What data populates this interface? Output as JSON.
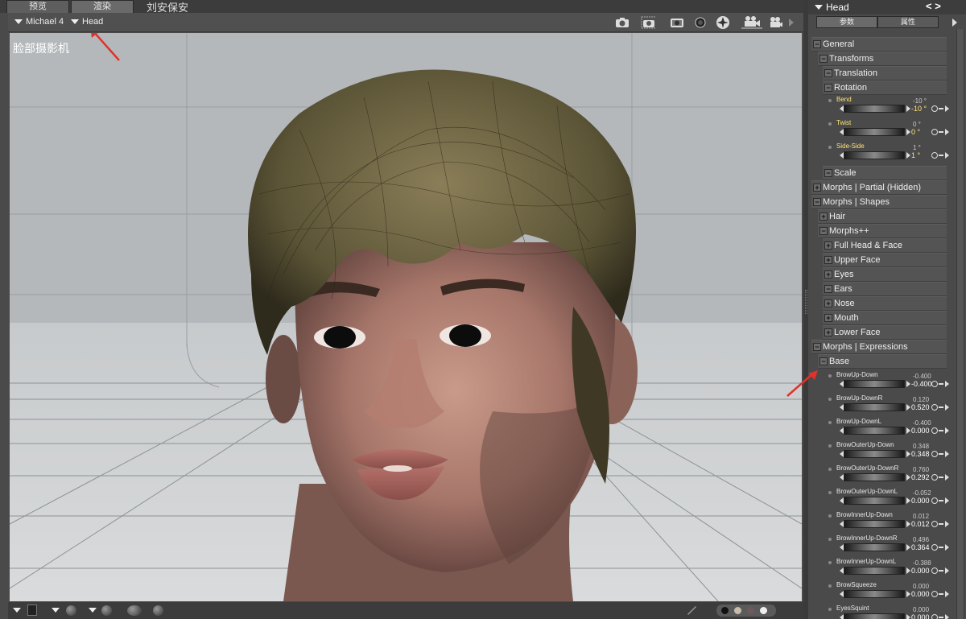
{
  "viewport": {
    "tabs": [
      "预览",
      "渲染"
    ],
    "username": "刘安保安",
    "figure_selector": "Michael 4",
    "part_selector": "Head",
    "camera_label": "脸部摄影机",
    "toolbar_icons": [
      "camera-icon",
      "camera-icon",
      "camera-icon",
      "circle-icon",
      "light-icon",
      "camera-icon",
      "camera-icon",
      "chevron-right-icon"
    ]
  },
  "panel": {
    "title": "Head",
    "tabs": [
      "参数",
      "属性"
    ],
    "groups": [
      {
        "label": "General",
        "state": "−"
      },
      {
        "label": "Transforms",
        "state": "−"
      },
      {
        "label": "Translation",
        "state": "−"
      },
      {
        "label": "Rotation",
        "state": "−"
      },
      {
        "label": "Scale",
        "state": "−"
      },
      {
        "label": "Morphs | Partial (Hidden)",
        "state": "+"
      },
      {
        "label": "Morphs | Shapes",
        "state": "−"
      },
      {
        "label": "Hair",
        "state": "+"
      },
      {
        "label": "Morphs++",
        "state": "−"
      },
      {
        "label": "Full Head & Face",
        "state": "+"
      },
      {
        "label": "Upper Face",
        "state": "+"
      },
      {
        "label": "Eyes",
        "state": "+"
      },
      {
        "label": "Ears",
        "state": "−"
      },
      {
        "label": "Nose",
        "state": "+"
      },
      {
        "label": "Mouth",
        "state": "+"
      },
      {
        "label": "Lower Face",
        "state": "+"
      },
      {
        "label": "Morphs | Expressions",
        "state": "−"
      },
      {
        "label": "Base",
        "state": "−"
      }
    ],
    "rotation_dials": [
      {
        "label": "Bend",
        "default": "-10 °",
        "value": "-10 °"
      },
      {
        "label": "Twist",
        "default": "0 °",
        "value": "0 °"
      },
      {
        "label": "Side-Side",
        "default": "1 °",
        "value": "1 °"
      }
    ],
    "base_dials": [
      {
        "label": "BrowUp-Down",
        "default": "-0.400",
        "value": "-0.400"
      },
      {
        "label": "BrowUp-DownR",
        "default": "0.120",
        "value": "0.520"
      },
      {
        "label": "BrowUp-DownL",
        "default": "-0.400",
        "value": "0.000"
      },
      {
        "label": "BrowOuterUp-Down",
        "default": "0.348",
        "value": "0.348"
      },
      {
        "label": "BrowOuterUp-DownR",
        "default": "0.760",
        "value": "0.292"
      },
      {
        "label": "BrowOuterUp-DownL",
        "default": "-0.052",
        "value": "0.000"
      },
      {
        "label": "BrowInnerUp-Down",
        "default": "0.012",
        "value": "0.012"
      },
      {
        "label": "BrowInnerUp-DownR",
        "default": "0.496",
        "value": "0.364"
      },
      {
        "label": "BrowInnerUp-DownL",
        "default": "-0.388",
        "value": "0.000"
      },
      {
        "label": "BrowSqueeze",
        "default": "0.000",
        "value": "0.000"
      },
      {
        "label": "EyesSquint",
        "default": "0.000",
        "value": "0.000"
      }
    ]
  },
  "colors": {
    "annotation_arrow": "#e0322c",
    "dial_label": "#ffe27a"
  }
}
